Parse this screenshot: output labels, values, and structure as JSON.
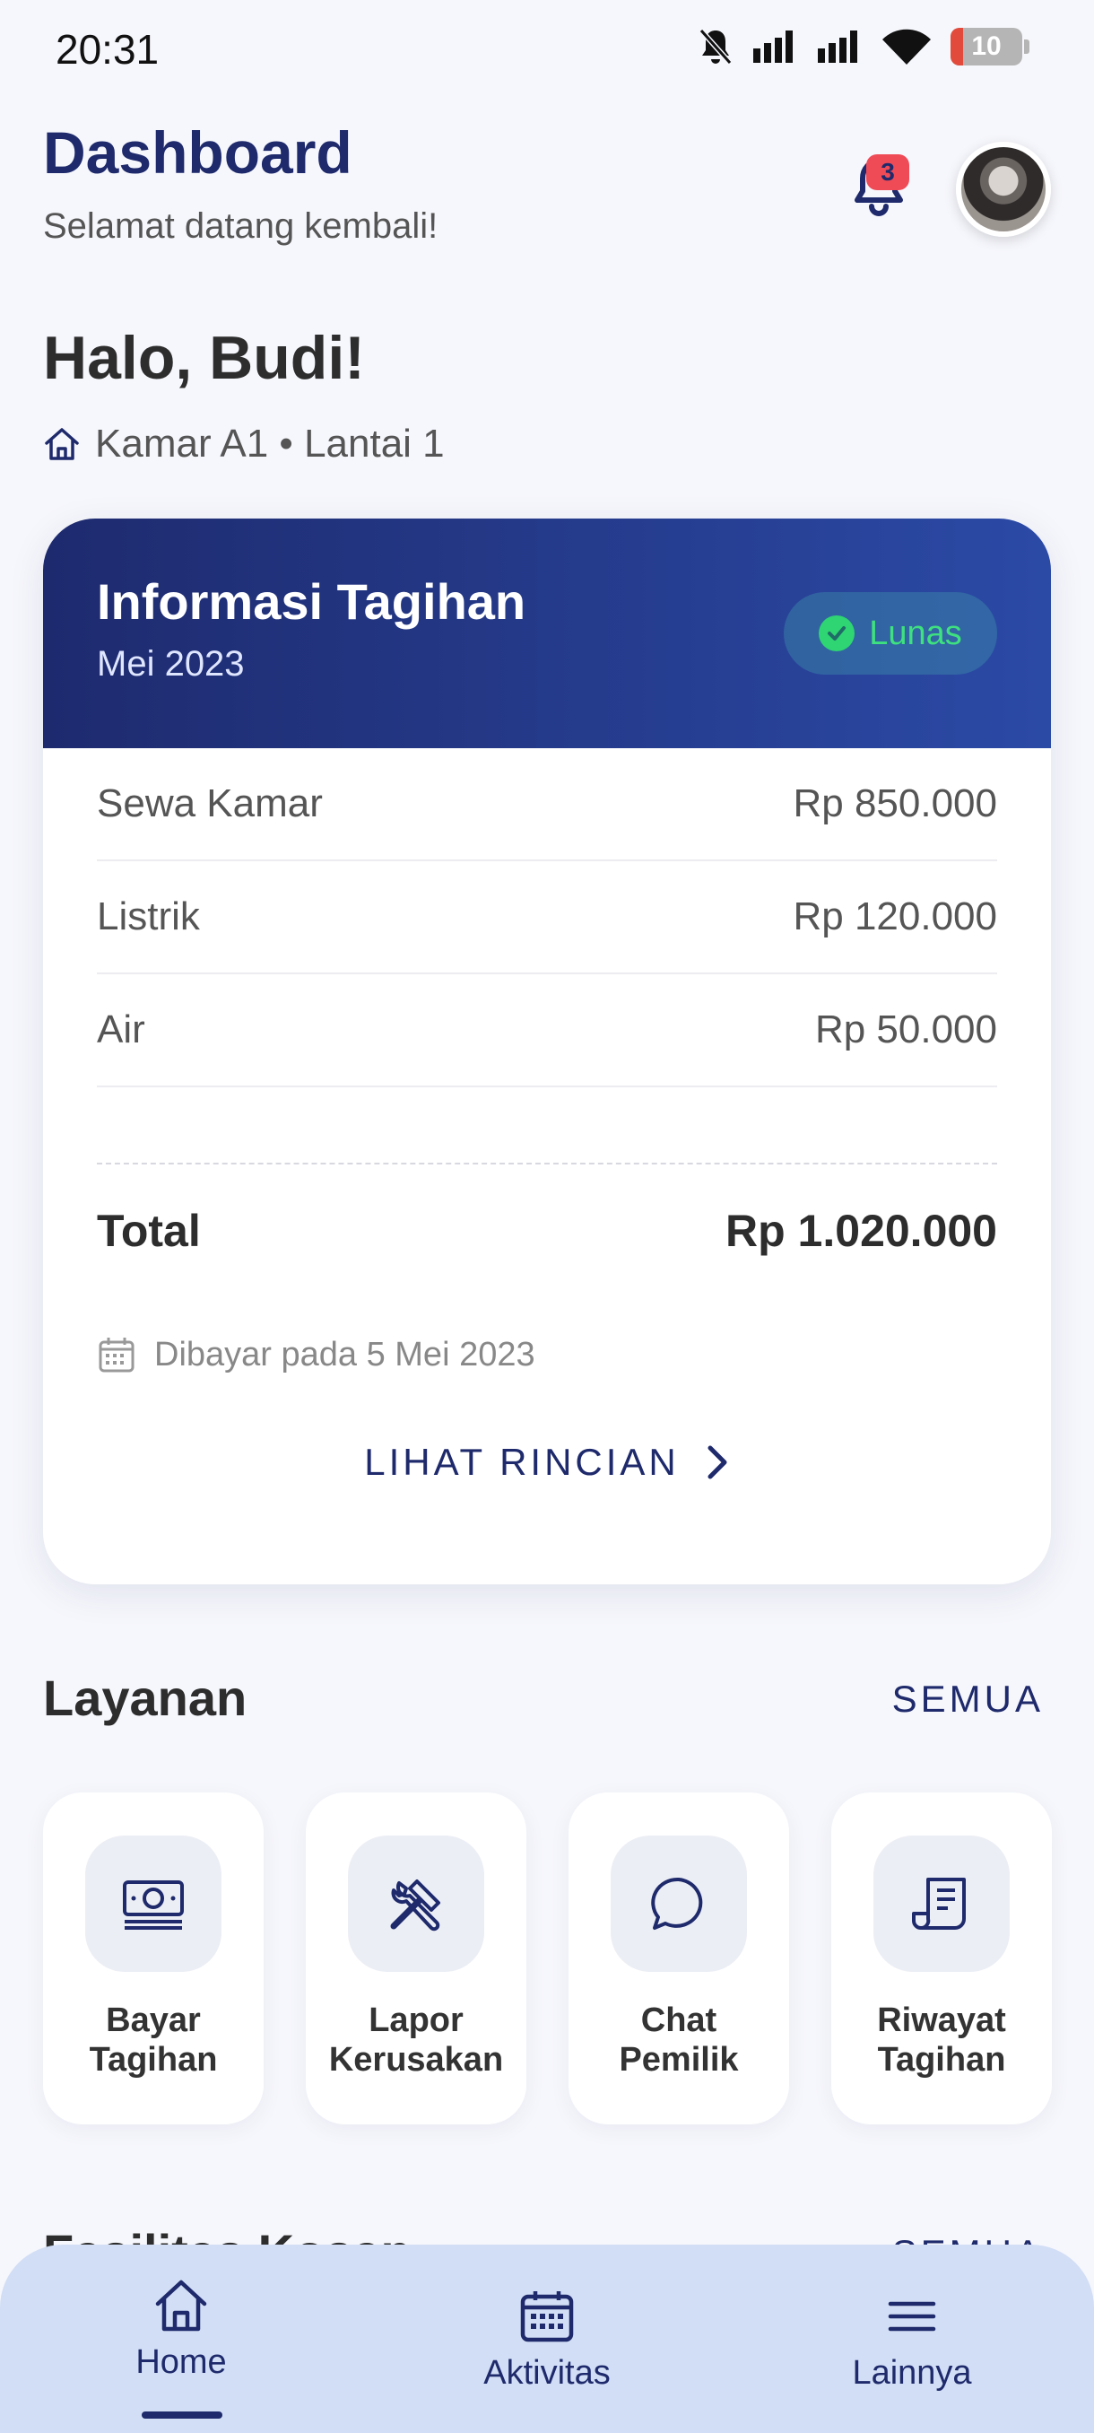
{
  "status_bar": {
    "time": "20:31",
    "battery": "10"
  },
  "header": {
    "title": "Dashboard",
    "subtitle": "Selamat datang kembali!",
    "notification_count": "3"
  },
  "greeting": "Halo, Budi!",
  "room": "Kamar A1 • Lantai 1",
  "bill": {
    "title": "Informasi Tagihan",
    "month": "Mei 2023",
    "status": "Lunas",
    "items": [
      {
        "label": "Sewa Kamar",
        "amount": "Rp 850.000"
      },
      {
        "label": "Listrik",
        "amount": "Rp 120.000"
      },
      {
        "label": "Air",
        "amount": "Rp 50.000"
      }
    ],
    "total_label": "Total",
    "total_amount": "Rp 1.020.000",
    "paid_date": "Dibayar pada 5 Mei 2023",
    "detail_link": "LIHAT RINCIAN"
  },
  "services": {
    "title": "Layanan",
    "see_all": "SEMUA",
    "items": [
      {
        "label": "Bayar\nTagihan",
        "icon": "money-icon"
      },
      {
        "label": "Lapor\nKerusakan",
        "icon": "tools-icon"
      },
      {
        "label": "Chat\nPemilik",
        "icon": "chat-icon"
      },
      {
        "label": "Riwayat\nTagihan",
        "icon": "receipt-icon"
      }
    ]
  },
  "facilities": {
    "title": "Fasilitas Kosan",
    "see_all": "SEMUA"
  },
  "nav": {
    "items": [
      {
        "label": "Home",
        "icon": "home-icon",
        "active": true
      },
      {
        "label": "Aktivitas",
        "icon": "calendar-icon",
        "active": false
      },
      {
        "label": "Lainnya",
        "icon": "menu-icon",
        "active": false
      }
    ]
  },
  "colors": {
    "primary": "#1e2a6b",
    "accent_gradient_end": "#2b4aa6",
    "success": "#2ed572",
    "badge": "#ef4b57",
    "nav_bg": "#d2def5",
    "background": "#f6f7fc"
  }
}
